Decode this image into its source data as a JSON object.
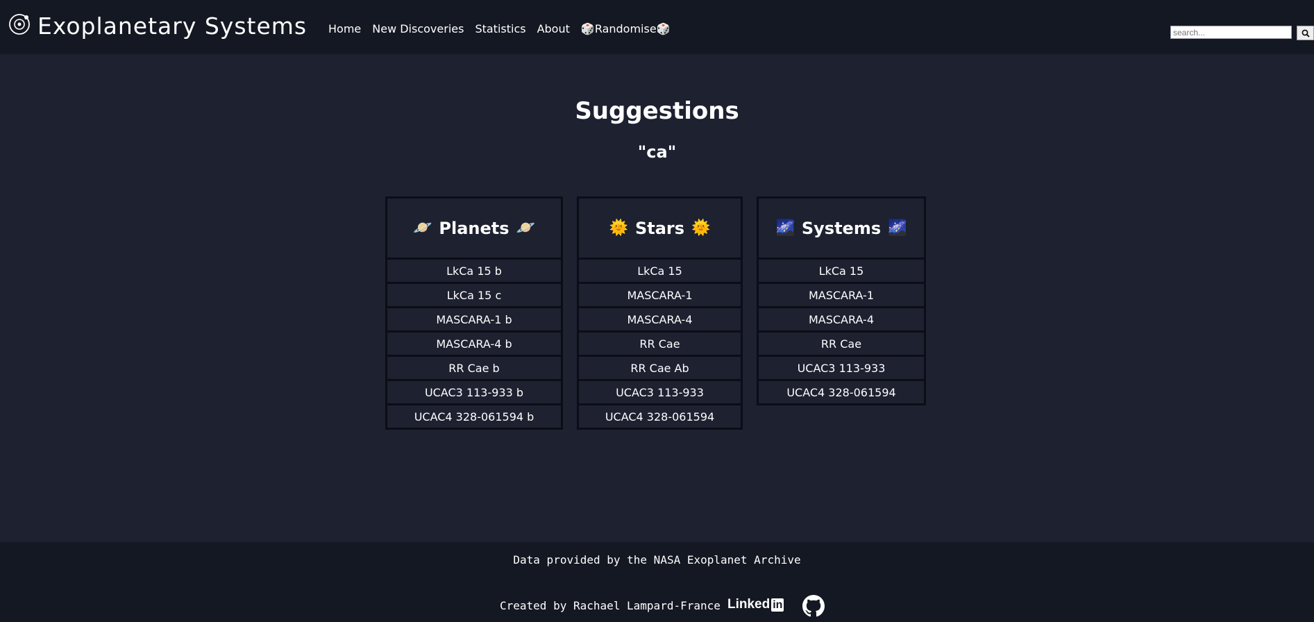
{
  "header": {
    "brand": "Exoplanetary Systems",
    "nav": [
      "Home",
      "New Discoveries",
      "Statistics",
      "About",
      "🎲Randomise🎲"
    ],
    "search_placeholder": "search..."
  },
  "main": {
    "title": "Suggestions",
    "query": "\"ca\"",
    "columns": [
      {
        "title": "Planets",
        "emoji": "🪐",
        "items": [
          "LkCa 15 b",
          "LkCa 15 c",
          "MASCARA-1 b",
          "MASCARA-4 b",
          "RR Cae b",
          "UCAC3 113-933 b",
          "UCAC4 328-061594 b"
        ]
      },
      {
        "title": "Stars",
        "emoji": "🌞",
        "items": [
          "LkCa 15",
          "MASCARA-1",
          "MASCARA-4",
          "RR Cae",
          "RR Cae Ab",
          "UCAC3 113-933",
          "UCAC4 328-061594"
        ]
      },
      {
        "title": "Systems",
        "emoji": "🌌",
        "items": [
          "LkCa 15",
          "MASCARA-1",
          "MASCARA-4",
          "RR Cae",
          "UCAC3 113-933",
          "UCAC4 328-061594"
        ]
      }
    ]
  },
  "footer": {
    "credit": "Data provided by the NASA Exoplanet Archive",
    "created": "Created by Rachael Lampard-France",
    "linkedin_text": "Linked",
    "linkedin_box": "in"
  },
  "colors": {
    "background": "#1d2130",
    "navbar": "#141822",
    "column_border": "#0b0e16",
    "text": "#ffffff"
  },
  "icons": {
    "logo": "planet-orbit-icon",
    "search": "magnifier-icon",
    "linkedin": "linkedin-icon",
    "github": "github-icon"
  }
}
